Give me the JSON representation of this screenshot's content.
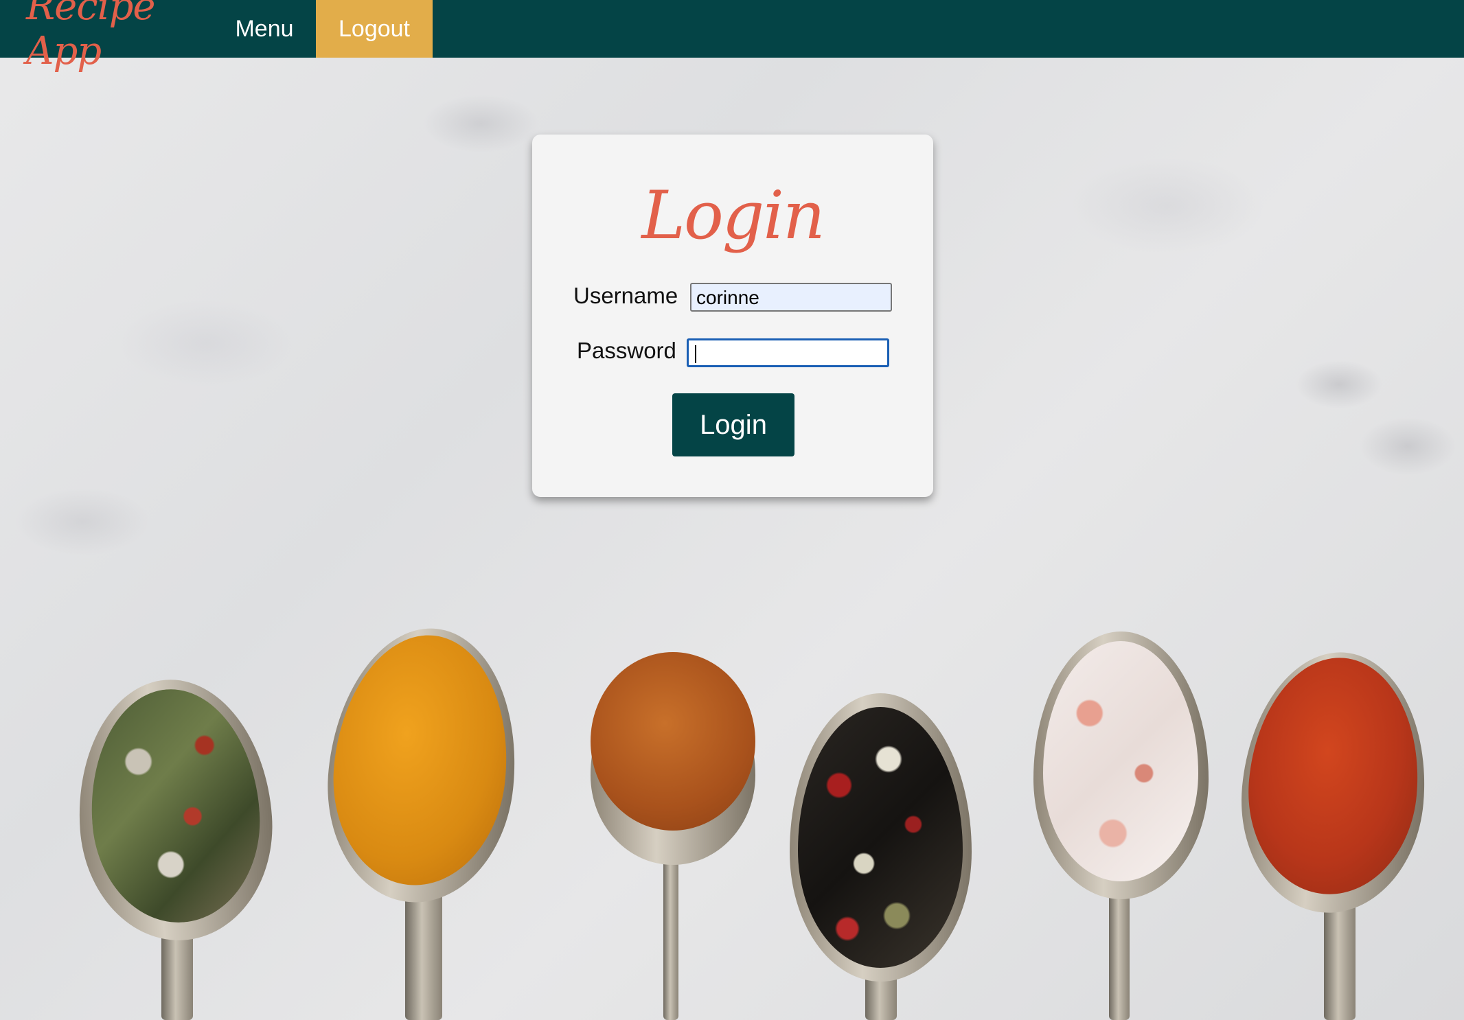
{
  "nav": {
    "brand": "Recipe App",
    "menu_label": "Menu",
    "logout_label": "Logout"
  },
  "login": {
    "title": "Login",
    "username_label": "Username",
    "username_value": "corinne",
    "password_label": "Password",
    "password_value": "",
    "submit_label": "Login"
  },
  "colors": {
    "navbar": "#044446",
    "brand": "#e2604a",
    "logout_active": "#e2ad4a",
    "button": "#044446"
  }
}
